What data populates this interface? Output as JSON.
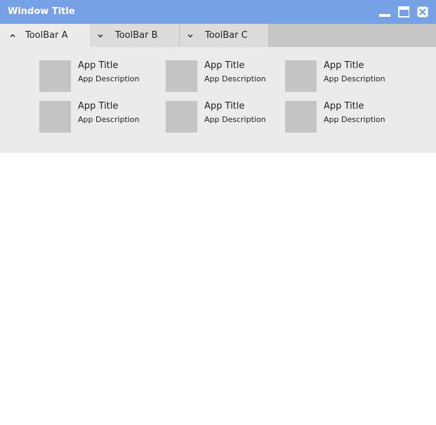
{
  "window": {
    "title": "Window Title",
    "colors": {
      "titlebar": "#77a1e5",
      "tabbar": "#c7c7c7",
      "panel": "#ebebeb",
      "thumbnail": "#c4c4c4"
    },
    "controls": {
      "minimize_icon": "minimize-icon",
      "maximize_icon": "maximize-icon",
      "close_icon": "close-icon"
    }
  },
  "toolbars": [
    {
      "label": "ToolBar A",
      "expanded": true,
      "icon": "chevron-up-icon"
    },
    {
      "label": "ToolBar B",
      "expanded": false,
      "icon": "chevron-down-icon"
    },
    {
      "label": "ToolBar C",
      "expanded": false,
      "icon": "chevron-down-icon"
    }
  ],
  "apps": [
    {
      "title": "App Title",
      "description": "App Description"
    },
    {
      "title": "App Title",
      "description": "App Description"
    },
    {
      "title": "App Title",
      "description": "App Description"
    },
    {
      "title": "App Title",
      "description": "App Description"
    },
    {
      "title": "App Title",
      "description": "App Description"
    },
    {
      "title": "App Title",
      "description": "App Description"
    }
  ]
}
